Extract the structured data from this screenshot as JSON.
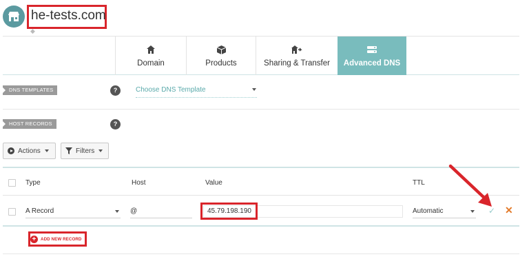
{
  "header": {
    "domain_title": "he-tests.com"
  },
  "tabs": [
    {
      "label": "Domain",
      "icon": "home-icon"
    },
    {
      "label": "Products",
      "icon": "box-icon"
    },
    {
      "label": "Sharing & Transfer",
      "icon": "share-icon"
    },
    {
      "label": "Advanced DNS",
      "icon": "dns-icon",
      "active": true
    }
  ],
  "dns_templates": {
    "tag": "DNS TEMPLATES",
    "help": "?",
    "select_value": "Choose DNS Template"
  },
  "host_records": {
    "tag": "HOST RECORDS",
    "help": "?"
  },
  "toolbar": {
    "actions_label": "Actions",
    "filters_label": "Filters"
  },
  "table": {
    "headers": {
      "type": "Type",
      "host": "Host",
      "value": "Value",
      "ttl": "TTL"
    },
    "row": {
      "type": "A Record",
      "host": "@",
      "value": "45.79.198.190",
      "ttl": "Automatic"
    }
  },
  "add_record_label": "ADD NEW RECORD",
  "colors": {
    "accent": "#79bcbd",
    "highlight": "#d9252b",
    "close": "#e37b2b"
  }
}
